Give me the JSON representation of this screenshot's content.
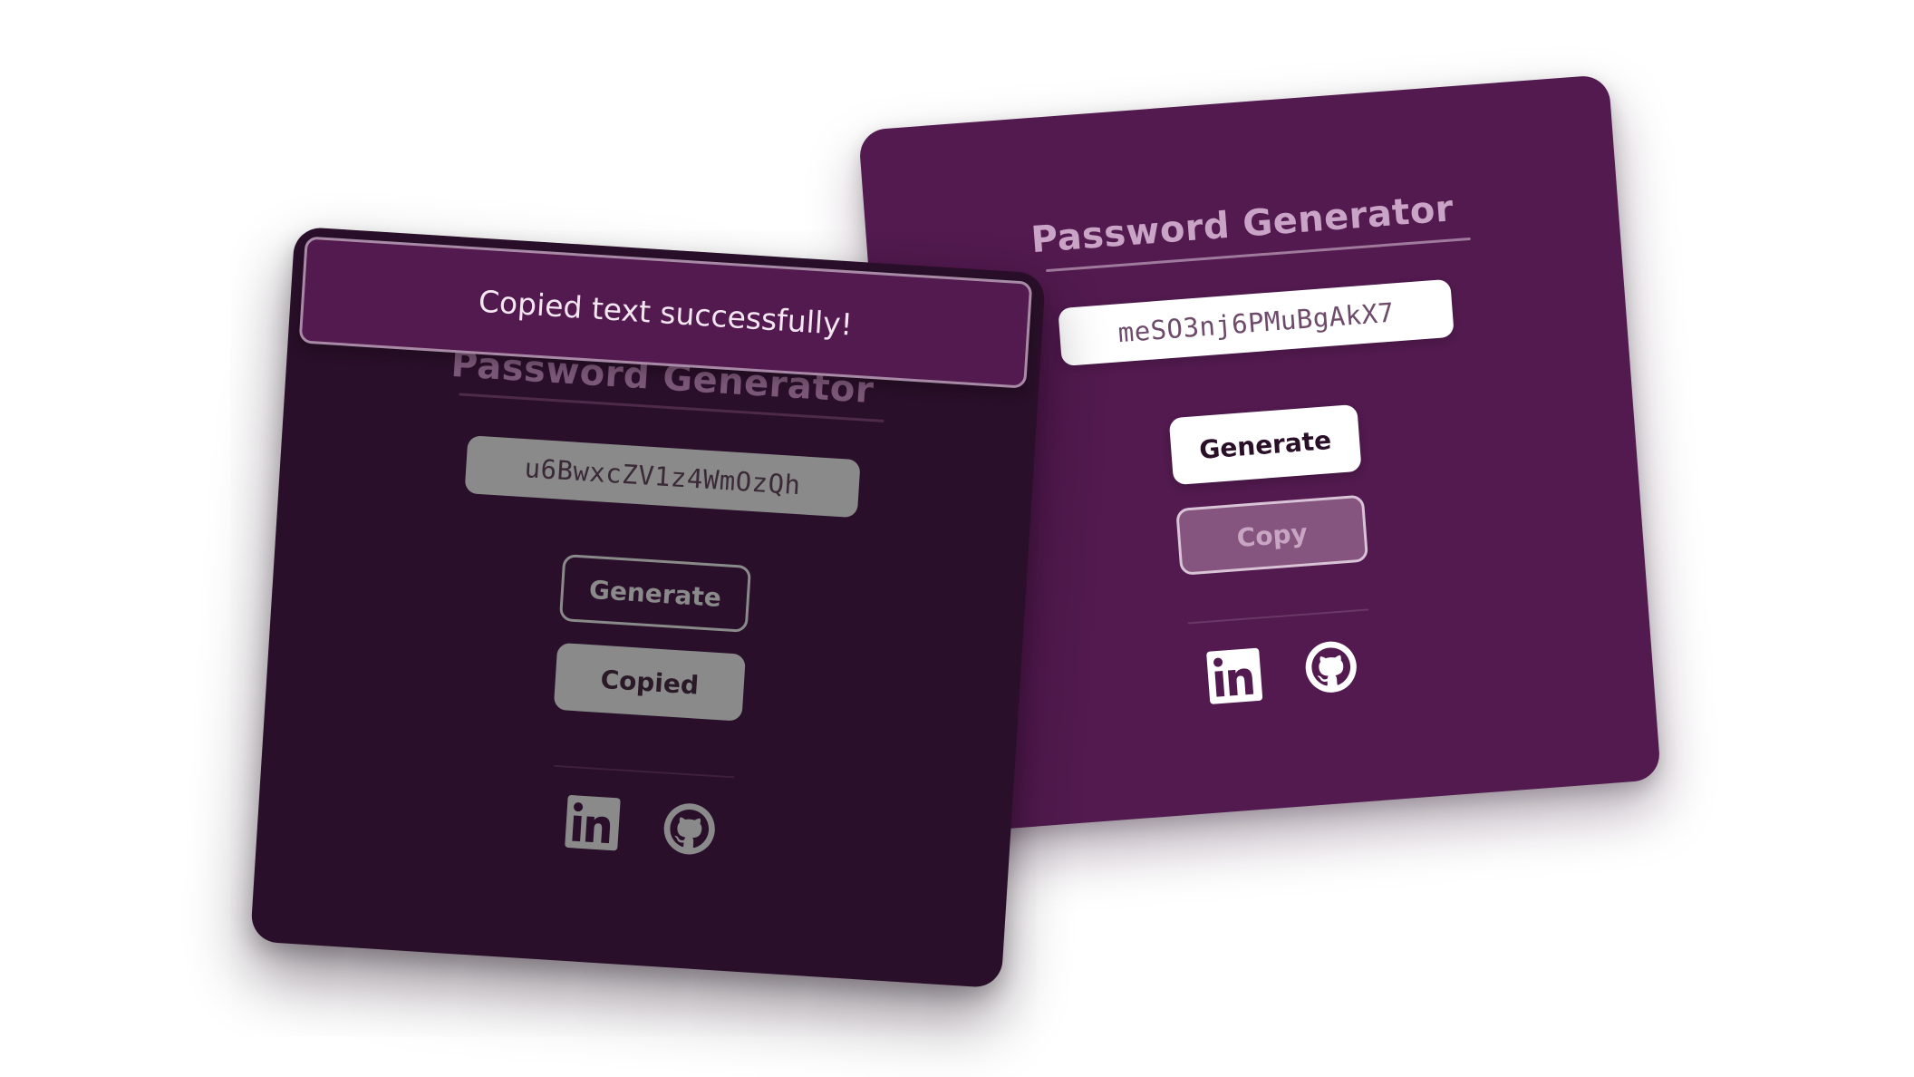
{
  "colors": {
    "back_card_bg": "#521a4f",
    "front_card_bg": "#290f29",
    "toast_bg": "#521a4f",
    "white": "#ffffff",
    "muted_gray": "#8a8a8a"
  },
  "back_card": {
    "title": "Password Generator",
    "password": "meSO3nj6PMuBgAkX7",
    "generate_label": "Generate",
    "copy_label": "Copy",
    "social": [
      {
        "name": "linkedin",
        "icon": "linkedin-icon"
      },
      {
        "name": "github",
        "icon": "github-icon"
      }
    ]
  },
  "front_card": {
    "toast_message": "Copied text successfully!",
    "title": "Password Generator",
    "password": "u6BwxcZV1z4WmOzQh",
    "generate_label": "Generate",
    "copied_label": "Copied",
    "social": [
      {
        "name": "linkedin",
        "icon": "linkedin-icon"
      },
      {
        "name": "github",
        "icon": "github-icon"
      }
    ]
  }
}
